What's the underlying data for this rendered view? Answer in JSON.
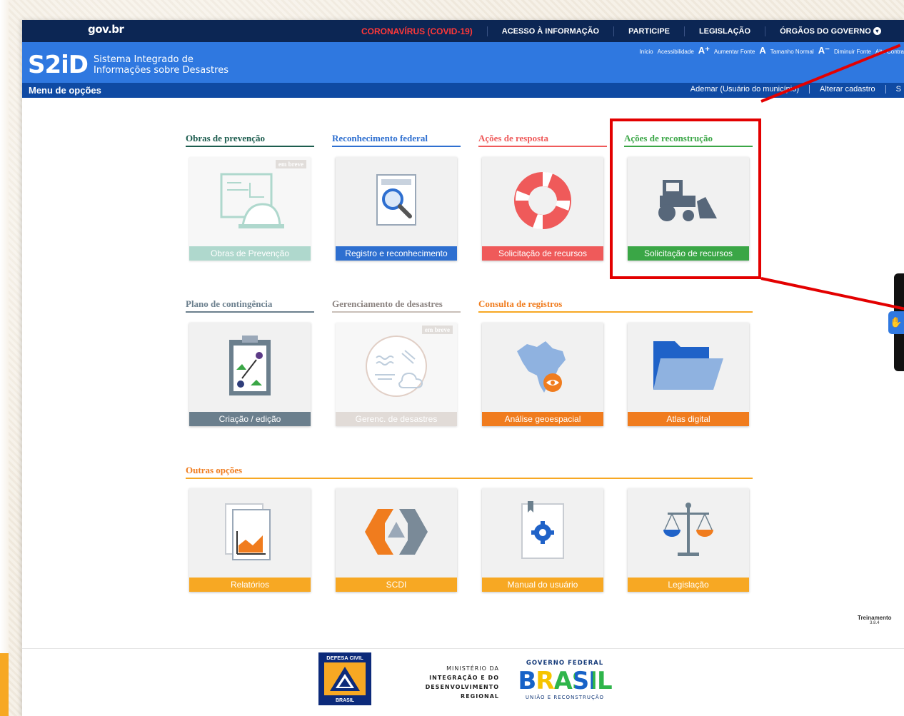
{
  "gov_bar": {
    "logo": "gov.br",
    "links": [
      "CORONAVÍRUS (COVID-19)",
      "ACESSO À INFORMAÇÃO",
      "PARTICIPE",
      "LEGISLAÇÃO",
      "ÓRGÃOS DO GOVERNO"
    ]
  },
  "header": {
    "logo": "S2iD",
    "title_line1": "Sistema Integrado de",
    "title_line2": "Informações sobre Desastres",
    "accessibility": {
      "inicio": "Início",
      "acessibilidade": "Acessibilidade",
      "aumentar_glyph": "A⁺",
      "aumentar": "Aumentar Fonte",
      "normal_glyph": "A",
      "normal": "Tamanho Normal",
      "diminuir_glyph": "A⁻",
      "diminuir": "Diminuir Fonte",
      "contraste": "Alto Contra"
    }
  },
  "menu_bar": {
    "title": "Menu de opções",
    "user": "Ademar (Usuário do município)",
    "alterar_cadastro": "Alterar cadastro",
    "sair": "S"
  },
  "sections": {
    "obras": "Obras de prevenção",
    "reconhecimento": "Reconhecimento federal",
    "resposta": "Ações de resposta",
    "reconstrucao": "Ações de reconstrução",
    "plano": "Plano de contingência",
    "gerenciamento": "Gerenciamento de desastres",
    "consulta": "Consulta de registros",
    "outras": "Outras opções"
  },
  "cards": {
    "obras": "Obras de Prevenção",
    "registro": "Registro e reconhecimento",
    "solic_resposta": "Solicitação de recursos",
    "solic_reconstrucao": "Solicitação de recursos",
    "criacao": "Criação / edição",
    "gerenc": "Gerenc. de desastres",
    "geoespacial": "Análise geoespacial",
    "atlas": "Atlas digital",
    "relatorios": "Relatórios",
    "scdi": "SCDI",
    "manual": "Manual do usuário",
    "legislacao": "Legislação"
  },
  "badges": {
    "em_breve": "em breve"
  },
  "version": {
    "env": "Treinamento",
    "number": "3.8.4"
  },
  "footer": {
    "defesa_top": "DEFESA CIVIL",
    "defesa_bottom": "BRASIL",
    "ministerio_1": "MINISTÉRIO DA",
    "ministerio_2": "INTEGRAÇÃO E DO",
    "ministerio_3": "DESENVOLVIMENTO",
    "ministerio_4": "REGIONAL",
    "governo_federal": "GOVERNO FEDERAL",
    "brasil": "BRASIL",
    "uniao": "UNIÃO E RECONSTRUÇÃO"
  },
  "colors": {
    "gov_navy": "#0c2654",
    "header_blue": "#2f78e0",
    "menu_blue": "#0f4aa3",
    "teal": "#6fb9a6",
    "blue": "#2e6fd0",
    "red": "#ef5a5a",
    "green": "#3aa646",
    "slate": "#6b7f8d",
    "orange": "#f7a823",
    "highlight": "#e30000"
  }
}
